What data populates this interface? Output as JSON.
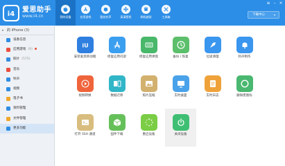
{
  "header": {
    "brand_name": "爱思助手",
    "brand_url": "www.i4.cn",
    "download_label": "下载中心",
    "nav": [
      {
        "label": "我的设备",
        "active": true
      },
      {
        "label": "应用游戏",
        "active": false
      },
      {
        "label": "酷炫铃声",
        "active": false
      },
      {
        "label": "高清壁纸",
        "active": false
      },
      {
        "label": "刷机越狱",
        "active": false
      },
      {
        "label": "工具箱",
        "active": false
      }
    ]
  },
  "sidebar": {
    "device_label": "的 iPhone (3)",
    "items": [
      {
        "label": "设备信息",
        "count": "",
        "color": "#2e8de4",
        "dot": false
      },
      {
        "label": "应用游戏",
        "count": "(9)",
        "color": "#ea4d3d",
        "dot": true
      },
      {
        "label": "照片",
        "count": "(575)",
        "color": "#2e8de4",
        "dot": false
      },
      {
        "label": "音乐",
        "count": "",
        "color": "#ea4d3d",
        "dot": false
      },
      {
        "label": "铃声",
        "count": "",
        "color": "#2e8de4",
        "dot": false
      },
      {
        "label": "视频",
        "count": "",
        "color": "#2e8de4",
        "dot": false
      },
      {
        "label": "电子书",
        "count": "",
        "color": "#f0a72a",
        "dot": false
      },
      {
        "label": "资料管理",
        "count": "",
        "color": "#2e8de4",
        "dot": false
      },
      {
        "label": "文件管理",
        "count": "",
        "color": "#f0a72a",
        "dot": false
      },
      {
        "label": "更多功能",
        "count": "",
        "color": "#2e8de4",
        "dot": false,
        "active": true
      }
    ]
  },
  "apps": [
    {
      "label": "安装爱思移动端",
      "color": "#2f7fe0",
      "icon": "i4-logo-icon"
    },
    {
      "label": "修复应用闪退",
      "color": "#3b9ff0",
      "icon": "app-store-icon"
    },
    {
      "label": "修复应用弹窗",
      "color": "#49b86a",
      "icon": "keyboard-icon"
    },
    {
      "label": "备份 / 恢复",
      "color": "#5cbf6b",
      "icon": "restore-icon"
    },
    {
      "label": "垃圾清理",
      "color": "#3a96ee",
      "icon": "broom-icon"
    },
    {
      "label": "铃声制作",
      "color": "#3a96ee",
      "icon": "bell-icon"
    },
    {
      "label": "视频转换",
      "color": "#f0643c",
      "icon": "video-icon"
    },
    {
      "label": "数据迁移",
      "color": "#31b6c8",
      "icon": "migrate-icon"
    },
    {
      "label": "照片压缩",
      "color": "#d2b06e",
      "icon": "photo-icon"
    },
    {
      "label": "实时桌面",
      "color": "#4aa2ea",
      "icon": "monitor-icon"
    },
    {
      "label": "实时日志",
      "color": "#f0a23a",
      "icon": "log-icon"
    },
    {
      "label": "删除废图标",
      "color": "#4ab870",
      "icon": "circle-icon"
    },
    {
      "label": "打开 SSH 通道",
      "color": "#d8bd7e",
      "icon": "terminal-icon"
    },
    {
      "label": "固件下载",
      "color": "#66c05a",
      "icon": "box-icon"
    },
    {
      "label": "重启设备",
      "color": "#7bcd45",
      "icon": "restart-icon"
    },
    {
      "label": "关闭设备",
      "color": "#3fbf73",
      "icon": "power-icon"
    }
  ]
}
